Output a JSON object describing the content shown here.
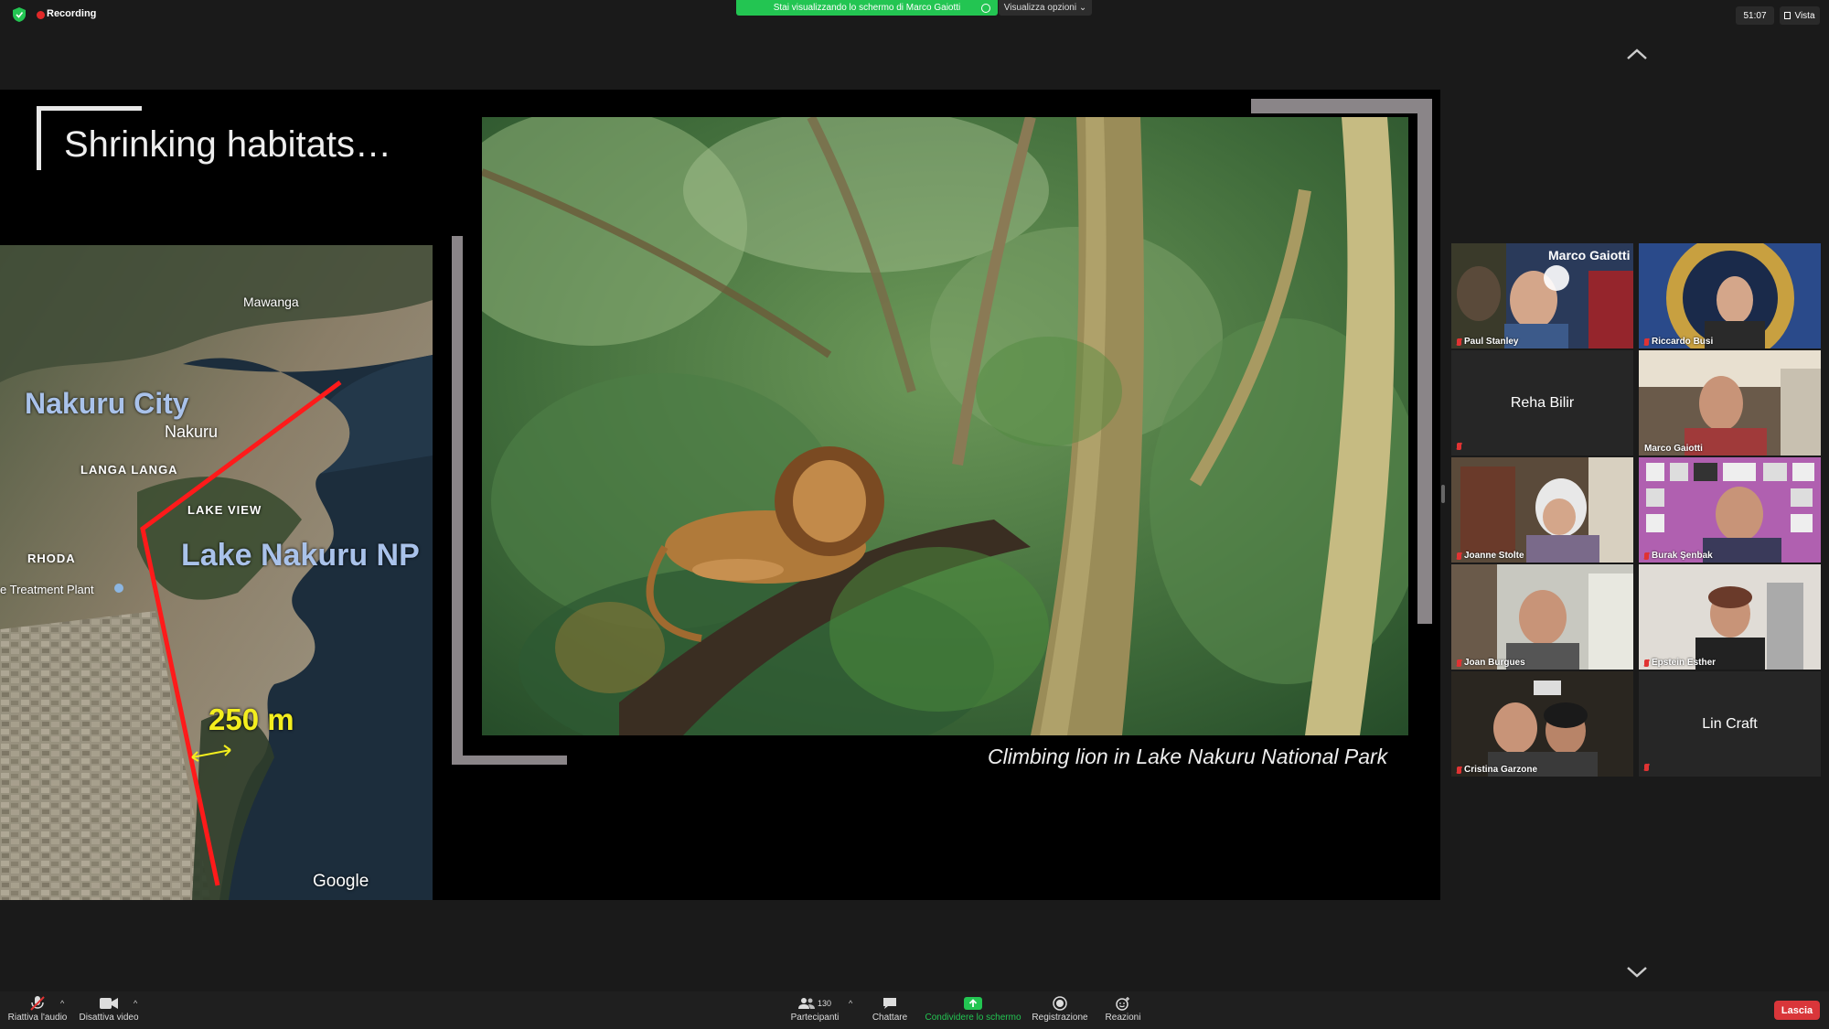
{
  "topbar": {
    "recording_label": "Recording",
    "sharing_banner": "Stai visualizzando lo schermo di Marco Gaiotti",
    "view_options_label": "Visualizza opzioni ⌄",
    "meeting_timer": "51:07",
    "view_label": "Vista"
  },
  "slide": {
    "title": "Shrinking habitats…",
    "caption": "Climbing lion in Lake Nakuru National Park",
    "map": {
      "labels": {
        "mawanga": "Mawanga",
        "nakuru_city": "Nakuru City",
        "nakuru": "Nakuru",
        "langa_langa": "LANGA LANGA",
        "lake_view": "LAKE VIEW",
        "rhoda": "RHODA",
        "lake_nakuru_np": "Lake Nakuru NP",
        "treatment_plant": "e Treatment Plant",
        "distance": "250 m",
        "google": "Google"
      }
    }
  },
  "gallery": {
    "participants": [
      {
        "name": "Paul Stanley",
        "banner": "Marco Gaiotti",
        "muted": true
      },
      {
        "name": "Riccardo Busi",
        "muted": true
      },
      {
        "name": "Reha Bilir",
        "video": false,
        "muted": true
      },
      {
        "name": "Marco Gaiotti",
        "active_speaker": true
      },
      {
        "name": "Joanne Stolte",
        "muted": true
      },
      {
        "name": "Burak Şenbak",
        "muted": true
      },
      {
        "name": "Joan Burgues",
        "muted": true
      },
      {
        "name": "Epstein Esther",
        "muted": true
      },
      {
        "name": "Cristina Garzone",
        "muted": true
      },
      {
        "name": "Lin Craft",
        "video": false,
        "muted": true
      }
    ]
  },
  "toolbar": {
    "unmute_label": "Riattiva l'audio",
    "stop_video_label": "Disattiva video",
    "participants_label": "Partecipanti",
    "participants_count": "130",
    "chat_label": "Chattare",
    "share_screen_label": "Condividere lo schermo",
    "record_label": "Registrazione",
    "reactions_label": "Reazioni",
    "leave_label": "Lascia"
  },
  "colors": {
    "share_green": "#23c552",
    "recording_red": "#e02828",
    "leave_red": "#d9363a",
    "active_speaker_border": "#c8d95a",
    "map_label_blue": "#a9c2ea",
    "distance_yellow": "#f3ee1e"
  }
}
